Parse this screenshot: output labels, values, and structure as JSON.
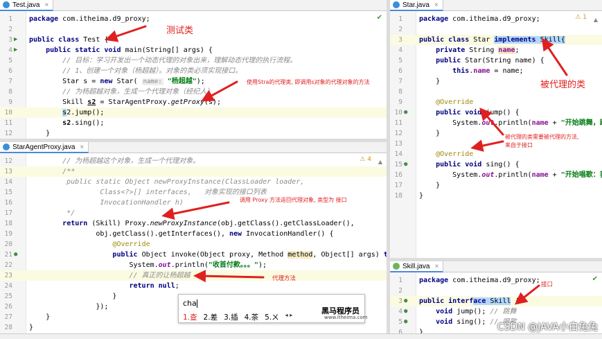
{
  "test_pane": {
    "tab_label": "Test.java",
    "lines": [
      {
        "n": "1",
        "html": "<span class='kw'>package</span> com.itheima.d9_proxy;"
      },
      {
        "n": "2",
        "html": ""
      },
      {
        "n": "3",
        "html": "<span class='kw'>public class</span> Test {",
        "gi": "▶"
      },
      {
        "n": "4",
        "html": "    <span class='kw'>public static void</span> main(String[] args) {",
        "gi": "▶"
      },
      {
        "n": "5",
        "html": "        <span class='cm'>// 目标：学习开发出一个动态代理的对象出来，理解动态代理的执行流程。</span>"
      },
      {
        "n": "6",
        "html": "        <span class='cm'>// 1、创建一个对象（杨超越）。对象的类必须实现接口。</span>"
      },
      {
        "n": "7",
        "html": "        Star s = <span class='kw'>new</span> Star( <span class='hint'>name:</span> <span class='str'>\"杨超越\"</span>);"
      },
      {
        "n": "8",
        "html": "        <span class='cm'>// 为杨超越对象，生成一个代理对象（经纪人）</span>"
      },
      {
        "n": "9",
        "html": "        Skill <span class='fld' style='color:#000;text-decoration:underline'>s2</span> = StarAgentProxy.<span class='ital'>getProxy</span>(s);"
      },
      {
        "n": "10",
        "html": "        <span class='sel'>s</span>2.jump();",
        "hl": true
      },
      {
        "n": "11",
        "html": "        <span class='fld' style='color:#000'>s2</span>.sing();"
      },
      {
        "n": "12",
        "html": "    }"
      }
    ]
  },
  "proxy_pane": {
    "tab_label": "StarAgentProxy.java",
    "warn_count": "4",
    "lines": [
      {
        "n": "12",
        "html": "        <span class='cm'>// 为杨超越这个对象，生成一个代理对象。</span>"
      },
      {
        "n": "13",
        "html": "        <span class='cm'>/**</span>",
        "hl": true
      },
      {
        "n": "14",
        "html": "<span class='cm'>         public static Object newProxyInstance(ClassLoader loader,</span>"
      },
      {
        "n": "15",
        "html": "<span class='cm'>                 Class&lt;?&gt;[] interfaces,   对象实现的接口列表</span>"
      },
      {
        "n": "16",
        "html": "<span class='cm'>                 InvocationHandler h)</span>"
      },
      {
        "n": "17",
        "html": "<span class='cm'>         */</span>"
      },
      {
        "n": "18",
        "html": "        <span class='kw'>return</span> (Skill) Proxy.<span class='ital'>newProxyInstance</span>(obj.getClass().getClassLoader(),"
      },
      {
        "n": "19",
        "html": "                obj.getClass().getInterfaces(), <span class='kw'>new</span> InvocationHandler() {"
      },
      {
        "n": "20",
        "html": "                    <span class='ann'>@Override</span>"
      },
      {
        "n": "21",
        "html": "                    <span class='kw'>public</span> Object invoke(Object proxy, Method <span class='warnhl'>method</span>, Object[] args) <span class='kw'>throws</span> <span style='color:#999'>Thro</span>",
        "gi": "●"
      },
      {
        "n": "22",
        "html": "                        System.<span class='fld ital'>out</span>.println(<span class='str'>\"收首付款。。。\"</span>);"
      },
      {
        "n": "23",
        "html": "                        <span class='cm'>// 真正的让杨超越</span>",
        "hl": true
      },
      {
        "n": "24",
        "html": "                        <span class='kw'>return null</span>;"
      },
      {
        "n": "25",
        "html": "                    }"
      },
      {
        "n": "26",
        "html": "                });"
      },
      {
        "n": "27",
        "html": "    }"
      },
      {
        "n": "28",
        "html": "}"
      }
    ]
  },
  "star_pane": {
    "tab_label": "Star.java",
    "warn_count": "1",
    "lines": [
      {
        "n": "1",
        "html": "<span class='kw'>package</span> com.itheima.d9_proxy;"
      },
      {
        "n": "2",
        "html": ""
      },
      {
        "n": "3",
        "html": "<span class='kw'>public class</span> Star <span class='sel'><span class='kw'>implements</span> Skill{</span>",
        "hl": true
      },
      {
        "n": "4",
        "html": "    <span class='kw'>private</span> String <span class='fld warnhl'>name</span>;"
      },
      {
        "n": "5",
        "html": "    <span class='kw'>public</span> Star(String <span class='par'>name</span>) {"
      },
      {
        "n": "6",
        "html": "        <span class='kw'>this</span>.<span class='fld'>name</span> = name;"
      },
      {
        "n": "7",
        "html": "    }"
      },
      {
        "n": "8",
        "html": ""
      },
      {
        "n": "9",
        "html": "    <span class='ann'>@Override</span>"
      },
      {
        "n": "10",
        "html": "    <span class='kw'>public void</span> jump() {",
        "gi": "●"
      },
      {
        "n": "11",
        "html": "        System.<span class='fld ital'>out</span>.println(<span class='fld'>name</span> + <span class='str'>\"开始跳舞，跳的很好</span>"
      },
      {
        "n": "12",
        "html": "    }"
      },
      {
        "n": "13",
        "html": ""
      },
      {
        "n": "14",
        "html": "    <span class='ann'>@Override</span>"
      },
      {
        "n": "15",
        "html": "    <span class='kw'>public void</span> sing() {",
        "gi": "●"
      },
      {
        "n": "16",
        "html": "        System.<span class='fld ital'>out</span>.println(<span class='fld'>name</span> + <span class='str'>\"开始唱歌：我们都是</span>"
      },
      {
        "n": "17",
        "html": "    }"
      },
      {
        "n": "18",
        "html": "}"
      }
    ]
  },
  "skill_pane": {
    "tab_label": "Skill.java",
    "lines": [
      {
        "n": "1",
        "html": "<span class='kw'>package</span> com.itheima.d9_proxy;"
      },
      {
        "n": "2",
        "html": ""
      },
      {
        "n": "3",
        "html": "<span class='kw'>public interf</span><span class='sel'><span class='kw'>ace</span> Skill</span> {",
        "gi": "●",
        "hl": true
      },
      {
        "n": "4",
        "html": "    <span class='kw'>void</span> jump(); <span class='cm'>// 跳舞</span>",
        "gi": "●"
      },
      {
        "n": "5",
        "html": "    <span class='kw'>void</span> sing(); <span class='cm'>// 唱歌</span>",
        "gi": "●"
      },
      {
        "n": "6",
        "html": "}"
      }
    ]
  },
  "annotations": {
    "test_class": "测试类",
    "use_star_proxy": "使用Stra的代理类, 即调用s对象的代理对象的方法",
    "proxied_class": "被代理的类",
    "proxied_methods_1": "被代理的类需要被代理的方法,",
    "proxied_methods_2": "来自于接口",
    "call_proxy_method": "调用 Proxy 方法返回代理对象, 类型为 接口",
    "proxy_method": "代理方法",
    "interface": "接口"
  },
  "ime": {
    "input": "cha",
    "candidates": [
      "1.查",
      "2.差",
      "3.插",
      "4.茶",
      "5.ㄨ"
    ],
    "nav": "◂ ▸"
  },
  "watermark": {
    "brand": "黑马程序员",
    "site": "www.itheima.com",
    "csdn": "CSDN @JAVA小白兔兔"
  },
  "colors": {
    "annotation_red": "#e02020",
    "selection": "#b3d7ff",
    "accent": "#4a89dc"
  }
}
